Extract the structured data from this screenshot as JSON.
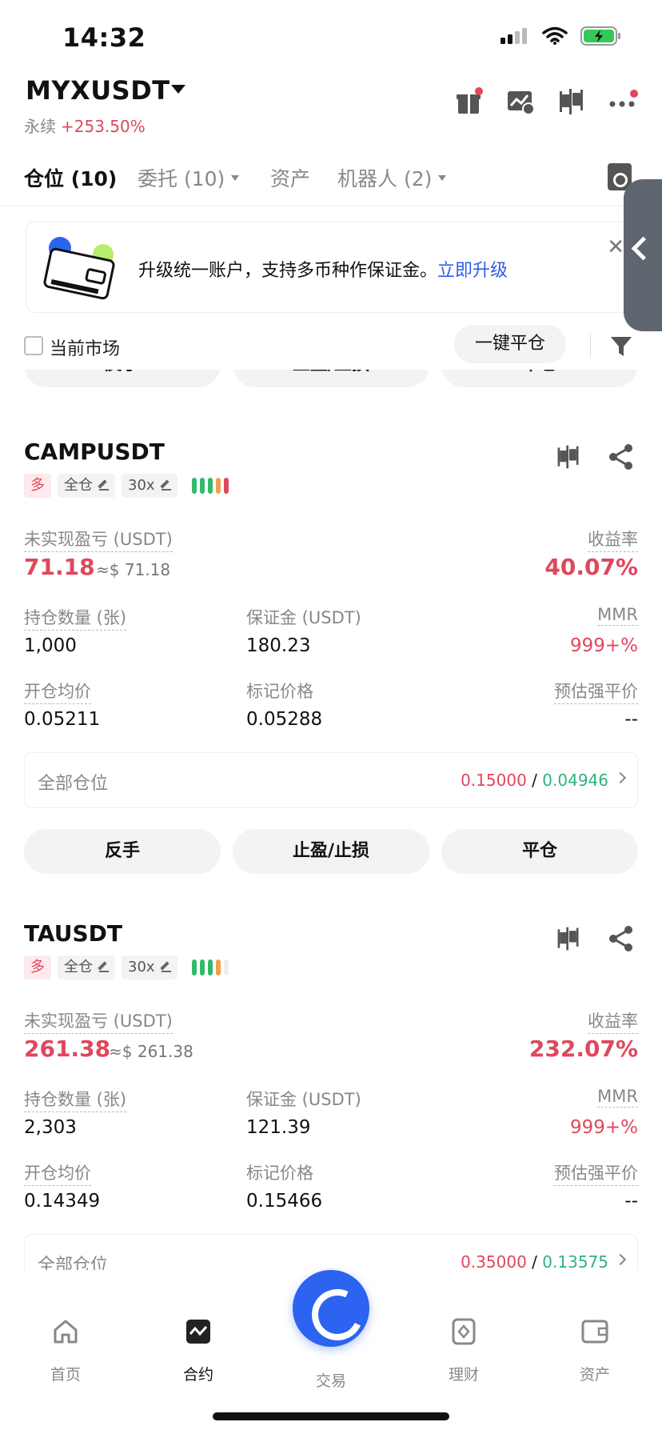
{
  "status": {
    "time": "14:32"
  },
  "header": {
    "symbol": "MYXUSDT",
    "contract_type": "永续",
    "change": "+253.50%"
  },
  "tabs": [
    {
      "label": "仓位 (10)",
      "active": true
    },
    {
      "label": "委托 (10)",
      "dropdown": true
    },
    {
      "label": "资产"
    },
    {
      "label": "机器人 (2)",
      "dropdown": true
    }
  ],
  "banner": {
    "text": "升级统一账户，支持多币种作保证金。",
    "link": "立即升级"
  },
  "filter": {
    "current_market": "当前市场",
    "close_all": "一键平仓"
  },
  "actions": {
    "reverse": "反手",
    "tpsl": "止盈/止损",
    "close": "平仓"
  },
  "labels": {
    "unrealized_pnl": "未实现盈亏 (USDT)",
    "roe": "收益率",
    "size": "持仓数量 (张)",
    "margin": "保证金 (USDT)",
    "mmr": "MMR",
    "entry_price": "开仓均价",
    "mark_price": "标记价格",
    "liq_price": "预估强平价",
    "all_positions": "全部仓位"
  },
  "positions": [
    {
      "symbol": "CAMPUSDT",
      "side": "多",
      "margin_mode": "全仓",
      "leverage": "30x",
      "pnl": "71.18",
      "pnl_usd": "≈$ 71.18",
      "roe": "40.07%",
      "size": "1,000",
      "margin": "180.23",
      "mmr": "999+%",
      "entry": "0.05211",
      "mark": "0.05288",
      "liq": "--",
      "all_red": "0.15000",
      "sep": "/",
      "all_green": "0.04946",
      "risk_bars": [
        "#33b96b",
        "#33b96b",
        "#33b96b",
        "#f0a04b",
        "#e0475c"
      ]
    },
    {
      "symbol": "TAUSDT",
      "side": "多",
      "margin_mode": "全仓",
      "leverage": "30x",
      "pnl": "261.38",
      "pnl_usd": "≈$ 261.38",
      "roe": "232.07%",
      "size": "2,303",
      "margin": "121.39",
      "mmr": "999+%",
      "entry": "0.14349",
      "mark": "0.15466",
      "liq": "--",
      "all_red": "0.35000",
      "sep": "/",
      "all_green": "0.13575",
      "risk_bars": [
        "#33b96b",
        "#33b96b",
        "#33b96b",
        "#f0a04b",
        "#eeeeee"
      ]
    }
  ],
  "nav": {
    "home": "首页",
    "futures": "合约",
    "trade": "交易",
    "earn": "理财",
    "assets": "资产"
  },
  "colors": {
    "accent_blue": "#2c63f0",
    "red": "#e0475c",
    "green": "#2eb37c"
  }
}
